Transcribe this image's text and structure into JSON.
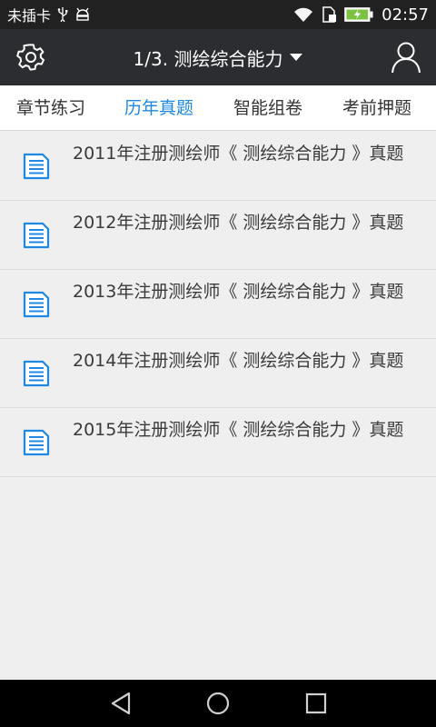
{
  "status_bar": {
    "carrier": "未插卡",
    "time": "02:57",
    "icons": [
      "usb-icon",
      "android-debug-icon",
      "wifi-icon",
      "sim-icon",
      "battery-charging-icon"
    ]
  },
  "app_bar": {
    "title": "1/3. 测绘综合能力",
    "icons": [
      "gear-icon",
      "caret-down-icon",
      "user-icon"
    ]
  },
  "tabs": [
    {
      "label": "章节练习",
      "active": false
    },
    {
      "label": "历年真题",
      "active": true
    },
    {
      "label": "智能组卷",
      "active": false
    },
    {
      "label": "考前押题",
      "active": false
    }
  ],
  "list": [
    {
      "title": "2011年注册测绘师《 测绘综合能力 》真题"
    },
    {
      "title": "2012年注册测绘师《 测绘综合能力 》真题"
    },
    {
      "title": "2013年注册测绘师《 测绘综合能力 》真题"
    },
    {
      "title": "2014年注册测绘师《 测绘综合能力 》真题"
    },
    {
      "title": "2015年注册测绘师《 测绘综合能力 》真题"
    }
  ],
  "nav_bar": {
    "icons": [
      "back-icon",
      "home-icon",
      "recents-icon"
    ]
  },
  "colors": {
    "accent": "#1e88e5",
    "app_bar_bg": "#2b2d31",
    "status_bar_bg": "#212121",
    "list_bg": "#efefef",
    "battery_green": "#7cc242"
  }
}
